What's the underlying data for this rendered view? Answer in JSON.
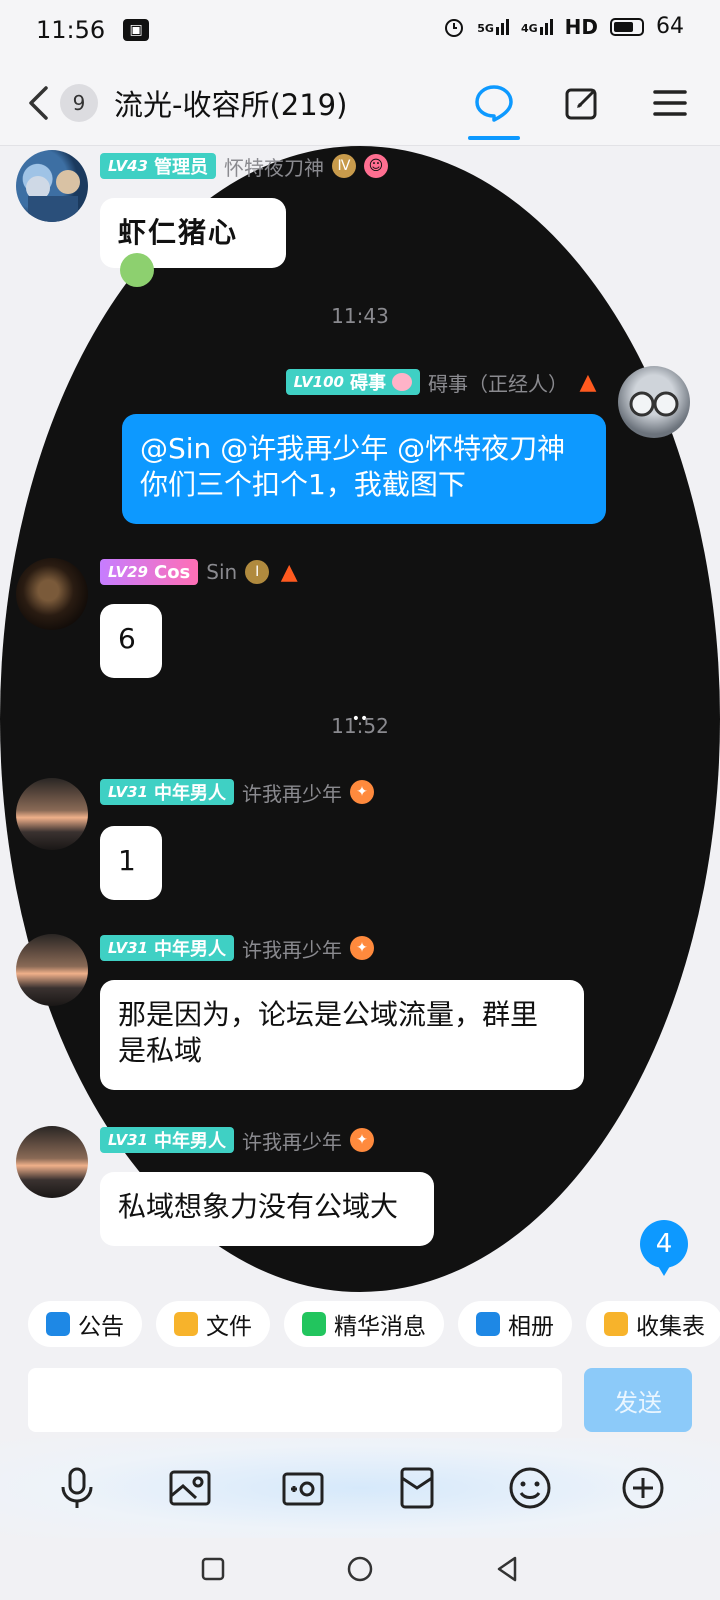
{
  "status_bar": {
    "time": "11:56",
    "network1": "5G",
    "network2": "4G",
    "hd": "HD",
    "battery": "64"
  },
  "header": {
    "unread_count": "9",
    "title": "流光-收容所(219)"
  },
  "messages": [
    {
      "level_tag": "LV43",
      "role_tag": "管理员",
      "nickname": "怀特夜刀神",
      "text": "虾仁猪心"
    },
    {
      "timestamp": "11:43"
    },
    {
      "level_tag": "LV100",
      "role_tag": "碍事",
      "nickname": "碍事（正经人）",
      "text_line1": "@Sin @许我再少年 @怀特夜刀神",
      "text_line2": "你们三个扣个1，我截图下"
    },
    {
      "level_tag": "LV29",
      "role_tag": "Cos",
      "nickname": "Sin",
      "text": "6"
    },
    {
      "timestamp": "11:52"
    },
    {
      "level_tag": "LV31",
      "role_tag": "中年男人",
      "nickname": "许我再少年",
      "text": "1"
    },
    {
      "level_tag": "LV31",
      "role_tag": "中年男人",
      "nickname": "许我再少年",
      "text_line1": "那是因为，论坛是公域流量，群里",
      "text_line2": "是私域"
    },
    {
      "level_tag": "LV31",
      "role_tag": "中年男人",
      "nickname": "许我再少年",
      "text": "私域想象力没有公域大"
    }
  ],
  "new_message_badge": "4",
  "quick_bar": [
    {
      "label": "公告",
      "icon": "announcement-icon",
      "color": "#1e88e5"
    },
    {
      "label": "文件",
      "icon": "folder-icon",
      "color": "#f7b32b"
    },
    {
      "label": "精华消息",
      "icon": "highlight-icon",
      "color": "#22c55e"
    },
    {
      "label": "相册",
      "icon": "album-icon",
      "color": "#1e88e5"
    },
    {
      "label": "收集表",
      "icon": "form-icon",
      "color": "#f7b32b"
    }
  ],
  "input": {
    "placeholder": "",
    "send_label": "发送"
  },
  "colors": {
    "accent": "#0d99ff",
    "tag_teal": "#3fd0c4",
    "background": "#f1f1f4"
  }
}
